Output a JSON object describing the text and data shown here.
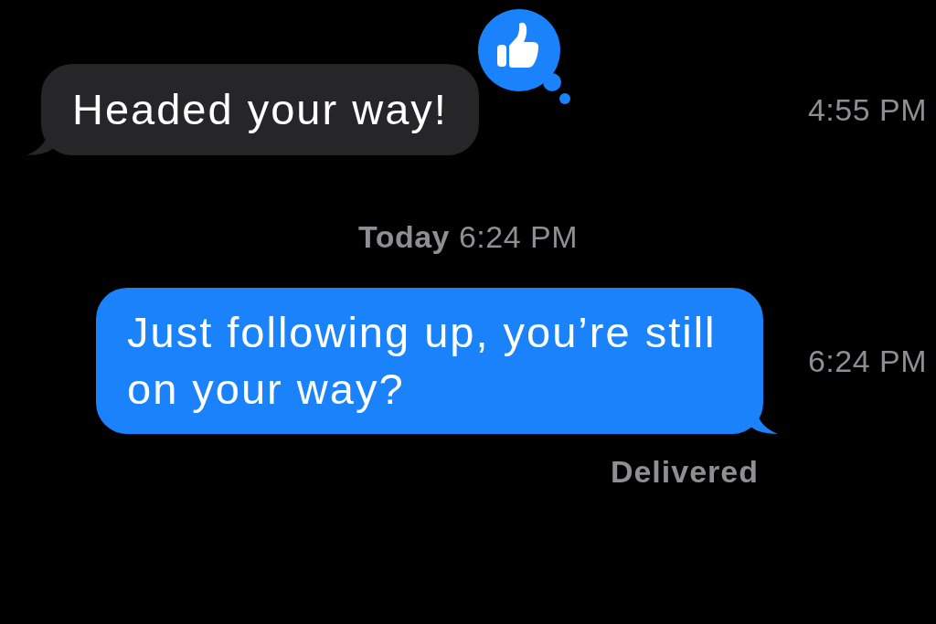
{
  "messages": [
    {
      "kind": "received",
      "text": "Headed your way!",
      "time": "4:55 PM",
      "reaction": {
        "kind": "thumbs-up"
      }
    },
    {
      "kind": "separator",
      "text": "**Today** 6:24 PM"
    },
    {
      "kind": "sent",
      "text": "Just following up, you’re still on your way?",
      "time": "6:24 PM",
      "status": "Delivered"
    }
  ]
}
